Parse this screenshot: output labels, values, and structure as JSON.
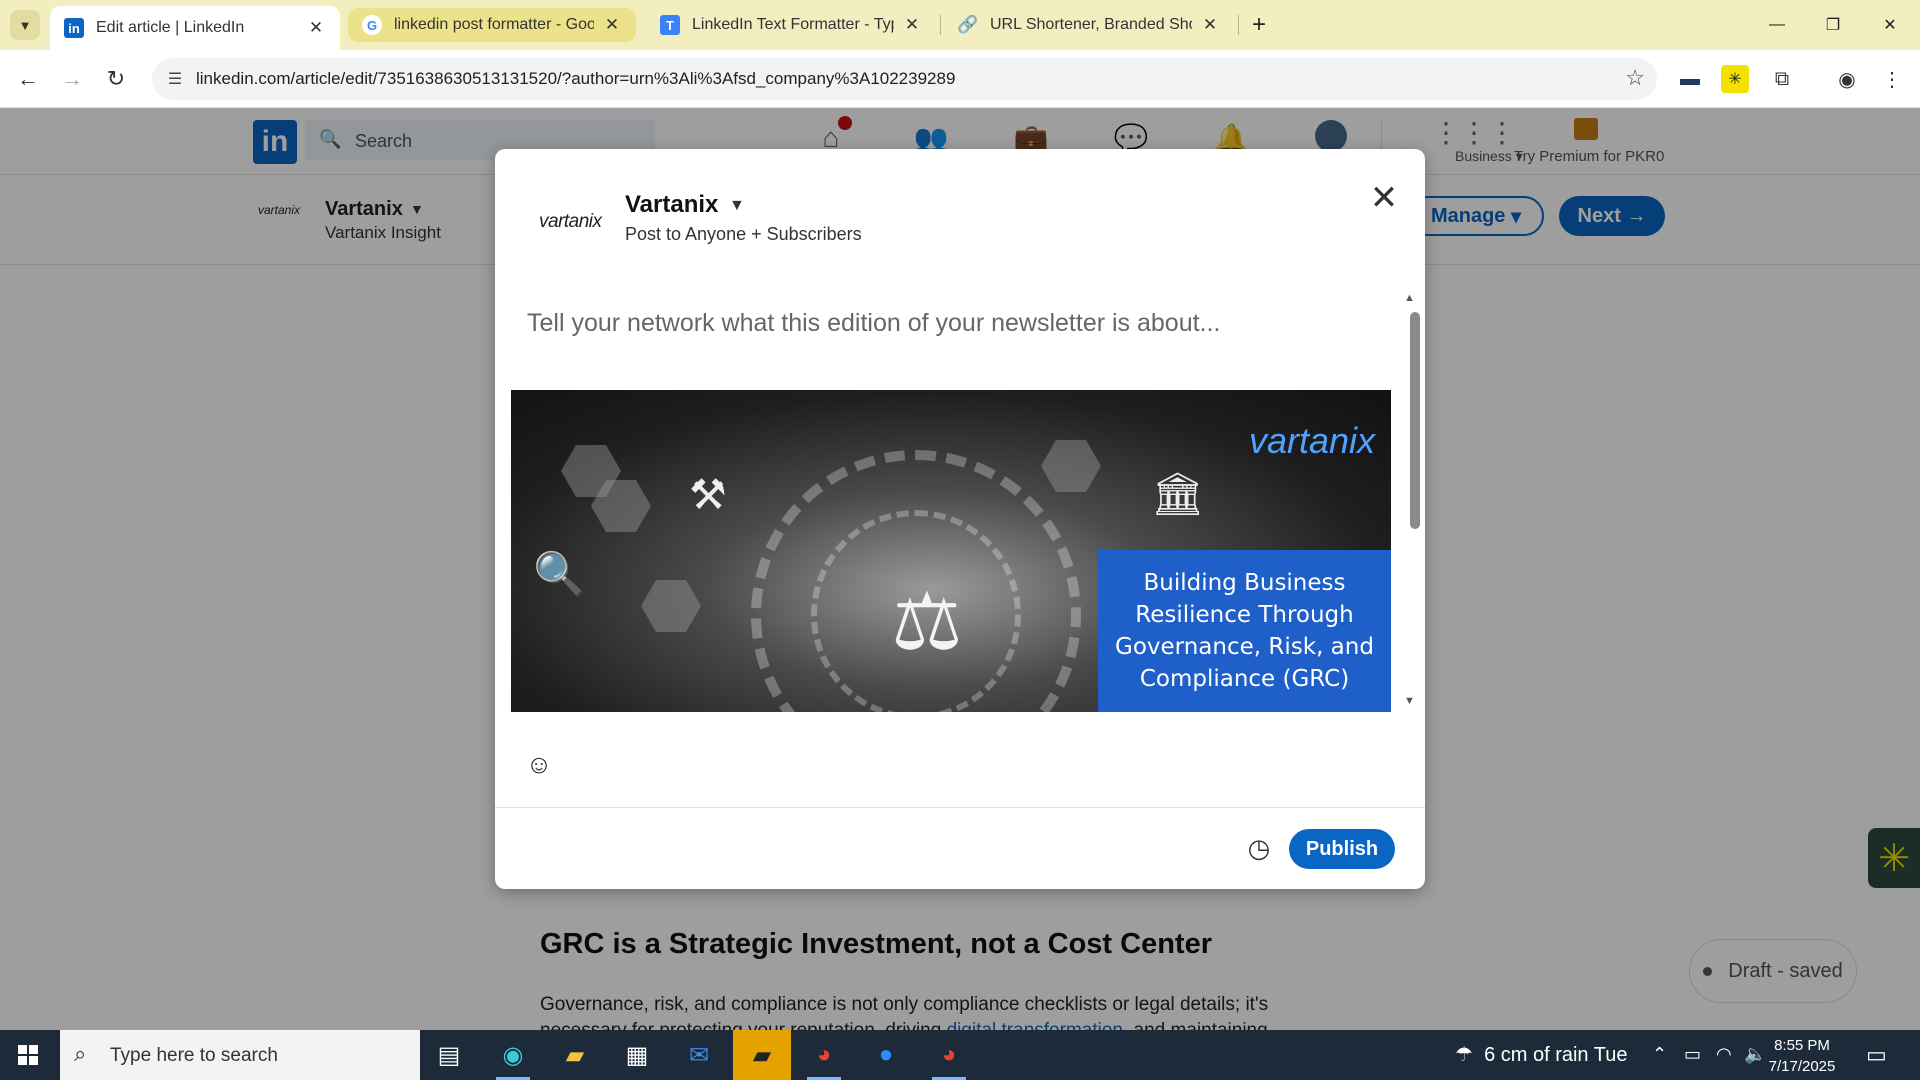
{
  "browser": {
    "tabs": [
      {
        "title": "Edit article | LinkedIn",
        "favicon": "linkedin-favicon",
        "active": true
      },
      {
        "title": "linkedin post formatter - Google",
        "favicon": "google-favicon",
        "highlighted": true
      },
      {
        "title": "LinkedIn Text Formatter - Typegrow",
        "favicon": "typegrow-favicon"
      },
      {
        "title": "URL Shortener, Branded Short Links",
        "favicon": "link-favicon"
      }
    ],
    "url": "linkedin.com/article/edit/7351638630513131520/?author=urn%3Ali%3Afsd_company%3A102239289",
    "tabstrip_color": "#f2eec0"
  },
  "linkedin": {
    "search_placeholder": "Search",
    "home_badge": "",
    "business_label": "Business",
    "premium_label": "Try Premium for PKR0",
    "brand_color": "#0a66c2",
    "company": {
      "name": "Vartanix",
      "description": "Vartanix Insight"
    },
    "manage_label": "Manage",
    "next_label": "Next",
    "article_heading": "GRC is a Strategic Investment, not a Cost Center",
    "article_text": "Governance, risk, and compliance is not only compliance checklists or legal details; it's",
    "article_text_2a": "necessary for protecting your reputation, driving ",
    "article_text_link": "digital transformation",
    "article_text_2b": ", and maintaining",
    "draft_status": "Draft - saved"
  },
  "modal": {
    "logo_text": "vartanix",
    "name": "Vartanix",
    "audience": "Post to Anyone + Subscribers",
    "placeholder": "Tell your network what this edition of your newsletter is about...",
    "banner": {
      "logo": "vartanix",
      "title": "Building Business Resilience Through Governance, Risk, and Compliance (GRC)",
      "box_color": "#1f5fc9"
    },
    "publish_label": "Publish"
  },
  "taskbar": {
    "search_placeholder": "Type here to search",
    "weather": "6 cm of rain Tue",
    "time": "8:55 PM",
    "date": "7/17/2025"
  }
}
